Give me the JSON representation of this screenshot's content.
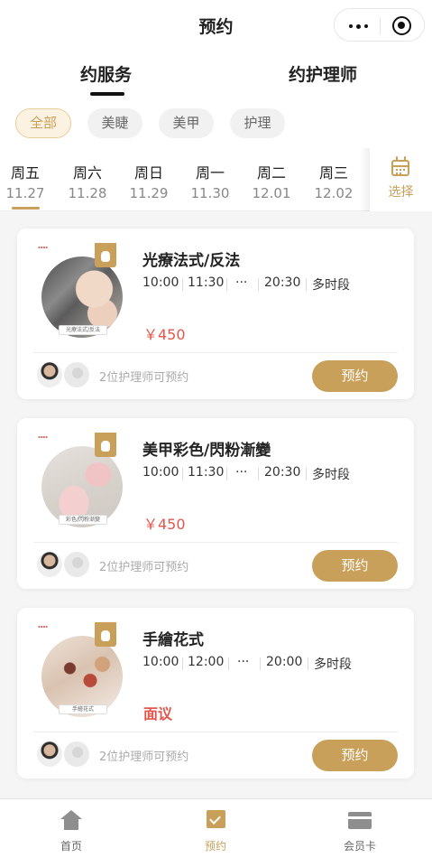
{
  "header": {
    "title": "预约"
  },
  "tabs": [
    {
      "label": "约服务"
    },
    {
      "label": "约护理师"
    }
  ],
  "filters": [
    {
      "label": "全部"
    },
    {
      "label": "美睫"
    },
    {
      "label": "美甲"
    },
    {
      "label": "护理"
    }
  ],
  "dates": [
    {
      "weekday": "周五",
      "date": "11.27"
    },
    {
      "weekday": "周六",
      "date": "11.28"
    },
    {
      "weekday": "周日",
      "date": "11.29"
    },
    {
      "weekday": "周一",
      "date": "11.30"
    },
    {
      "weekday": "周二",
      "date": "12.01"
    },
    {
      "weekday": "周三",
      "date": "12.02"
    }
  ],
  "date_picker": {
    "label": "选择"
  },
  "services": [
    {
      "name": "光療法式/反法",
      "thumb_caption": "光療法式/反法",
      "slots": [
        "10:00",
        "11:30",
        "···",
        "20:30",
        "多时段"
      ],
      "price": "￥450",
      "available": "2位护理师可预约",
      "book_label": "预约"
    },
    {
      "name": "美甲彩色/閃粉漸變",
      "thumb_caption": "彩色/閃粉漸變",
      "slots": [
        "10:00",
        "11:30",
        "···",
        "20:30",
        "多时段"
      ],
      "price": "￥450",
      "available": "2位护理师可预约",
      "book_label": "预约"
    },
    {
      "name": "手繪花式",
      "thumb_caption": "手繪花式",
      "slots": [
        "10:00",
        "12:00",
        "···",
        "20:00",
        "多时段"
      ],
      "price": "面议",
      "available": "2位护理师可预约",
      "book_label": "预约"
    }
  ],
  "tabbar": [
    {
      "label": "首页"
    },
    {
      "label": "预约"
    },
    {
      "label": "会员卡"
    }
  ],
  "colors": {
    "accent": "#c9a05a",
    "price": "#e2574c"
  }
}
